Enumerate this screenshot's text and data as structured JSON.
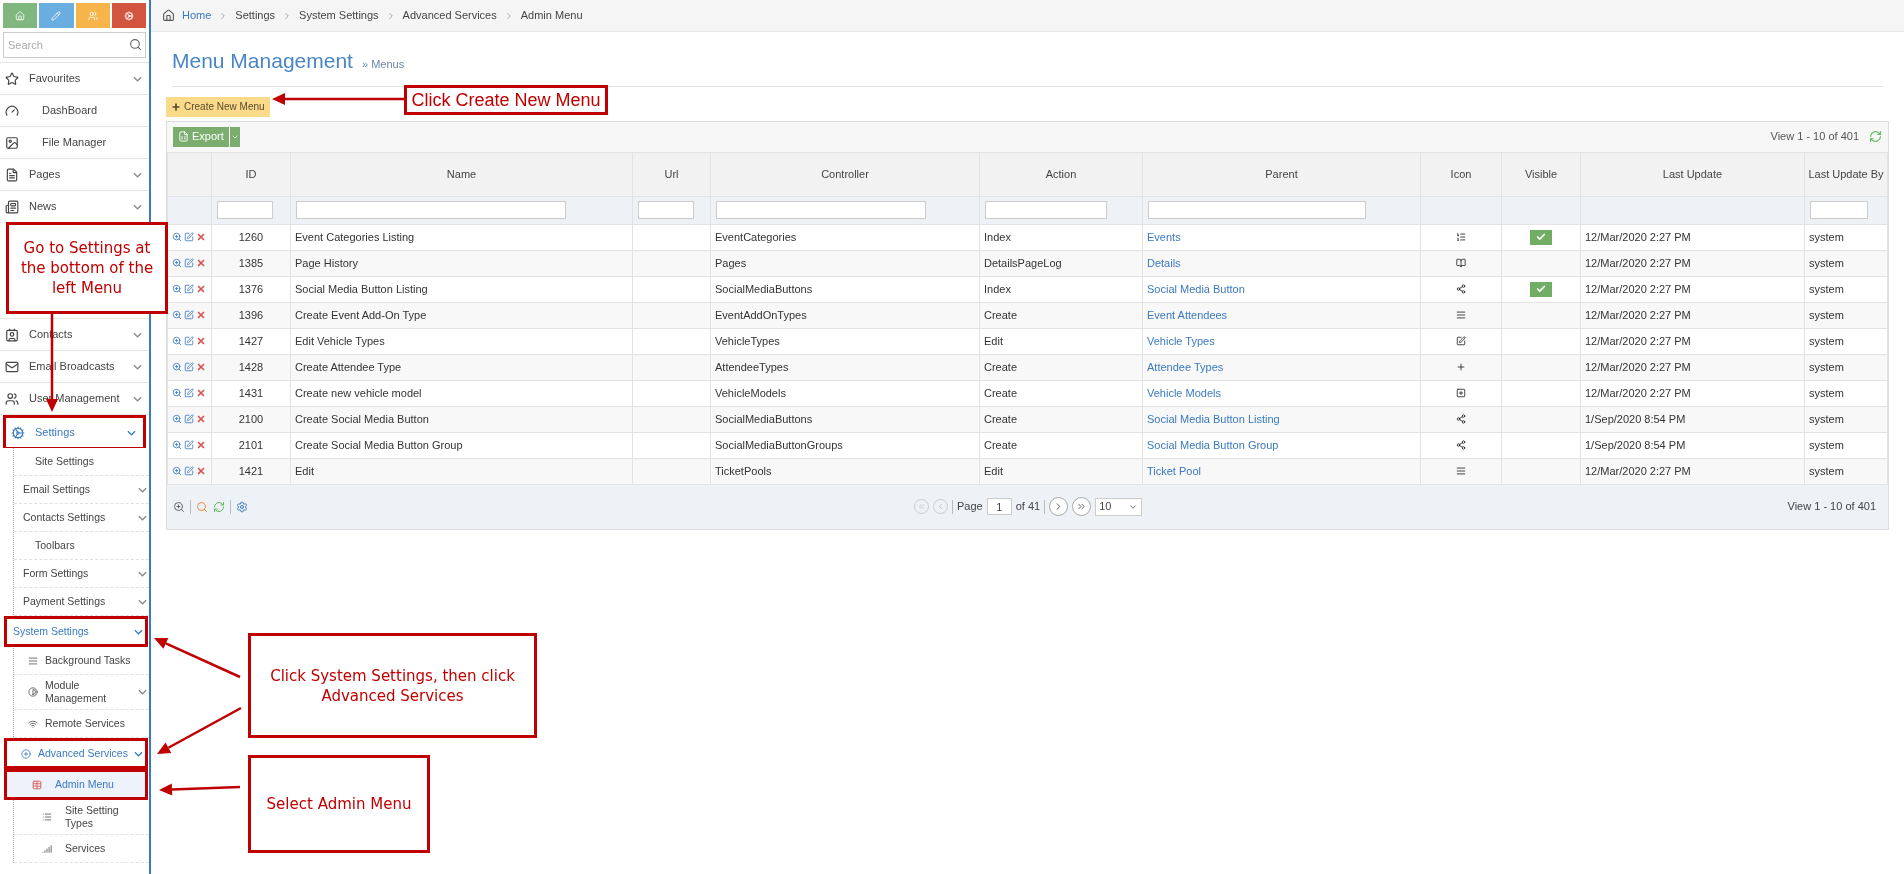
{
  "sidebar": {
    "search": {
      "placeholder": "Search"
    },
    "items": [
      {
        "label": "Favourites",
        "expanded": false,
        "selected": false
      },
      {
        "label": "DashBoard",
        "selected": false
      },
      {
        "label": "File Manager",
        "selected": false
      },
      {
        "label": "Pages",
        "expanded": false,
        "selected": false
      },
      {
        "label": "News",
        "expanded": false,
        "selected": false
      },
      {
        "label": "Contacts",
        "expanded": false,
        "selected": false
      },
      {
        "label": "Email Broadcasts",
        "expanded": false,
        "selected": false
      },
      {
        "label": "User Management",
        "expanded": false,
        "selected": false
      },
      {
        "label": "Settings",
        "expanded": true,
        "selected": false,
        "highlighted": true,
        "children": [
          {
            "label": "Site Settings",
            "selected": false
          },
          {
            "label": "Email Settings",
            "expanded": false,
            "selected": false
          },
          {
            "label": "Contacts Settings",
            "expanded": false,
            "selected": false
          },
          {
            "label": "Toolbars",
            "selected": false
          },
          {
            "label": "Form Settings",
            "expanded": false,
            "selected": false
          },
          {
            "label": "Payment Settings",
            "expanded": false,
            "selected": false
          },
          {
            "label": "System Settings",
            "expanded": true,
            "selected": false,
            "highlighted": true,
            "children": [
              {
                "label": "Background Tasks",
                "selected": false
              },
              {
                "label": "Module Management",
                "expanded": false,
                "selected": false
              },
              {
                "label": "Remote Services",
                "selected": false
              },
              {
                "label": "Advanced Services",
                "expanded": true,
                "selected": false,
                "highlighted": true,
                "children": [
                  {
                    "label": "Admin Menu",
                    "selected": true,
                    "highlighted": true
                  },
                  {
                    "label": "Site Setting Types",
                    "selected": false
                  },
                  {
                    "label": "Services",
                    "selected": false
                  }
                ]
              }
            ]
          }
        ]
      }
    ]
  },
  "breadcrumb": [
    "Home",
    "Settings",
    "System Settings",
    "Advanced Services",
    "Admin Menu"
  ],
  "page": {
    "title": "Menu Management",
    "subtitle": "» Menus",
    "create_button": "Create New Menu"
  },
  "table": {
    "export_button": "Export",
    "view_text": "View 1 - 10 of 401",
    "columns": [
      {
        "label": "ID",
        "filter": true
      },
      {
        "label": "Name",
        "filter": true
      },
      {
        "label": "Url",
        "filter": true
      },
      {
        "label": "Controller",
        "filter": true
      },
      {
        "label": "Action",
        "filter": true
      },
      {
        "label": "Parent",
        "filter": true
      },
      {
        "label": "Icon",
        "filter": false
      },
      {
        "label": "Visible",
        "filter": false
      },
      {
        "label": "Last Update",
        "filter": false
      },
      {
        "label": "Last Update By",
        "filter": true
      }
    ],
    "rows": [
      {
        "id": "1260",
        "name": "Event Categories Listing",
        "controller": "EventCategories",
        "action": "Index",
        "parent": "Events",
        "visible": true,
        "last_update": "12/Mar/2020 2:27 PM",
        "last_update_by": "system"
      },
      {
        "id": "1385",
        "name": "Page History",
        "controller": "Pages",
        "action": "DetailsPageLog",
        "parent": "Details",
        "visible": false,
        "last_update": "12/Mar/2020 2:27 PM",
        "last_update_by": "system"
      },
      {
        "id": "1376",
        "name": "Social Media Button Listing",
        "controller": "SocialMediaButtons",
        "action": "Index",
        "parent": "Social Media Button",
        "visible": true,
        "last_update": "12/Mar/2020 2:27 PM",
        "last_update_by": "system"
      },
      {
        "id": "1396",
        "name": "Create Event Add-On Type",
        "controller": "EventAddOnTypes",
        "action": "Create",
        "parent": "Event Attendees",
        "visible": false,
        "last_update": "12/Mar/2020 2:27 PM",
        "last_update_by": "system"
      },
      {
        "id": "1427",
        "name": "Edit Vehicle Types",
        "controller": "VehicleTypes",
        "action": "Edit",
        "parent": "Vehicle Types",
        "visible": false,
        "last_update": "12/Mar/2020 2:27 PM",
        "last_update_by": "system"
      },
      {
        "id": "1428",
        "name": "Create Attendee Type",
        "controller": "AttendeeTypes",
        "action": "Create",
        "parent": "Attendee Types",
        "visible": false,
        "last_update": "12/Mar/2020 2:27 PM",
        "last_update_by": "system"
      },
      {
        "id": "1431",
        "name": "Create new vehicle model",
        "controller": "VehicleModels",
        "action": "Create",
        "parent": "Vehicle Models",
        "visible": false,
        "last_update": "12/Mar/2020 2:27 PM",
        "last_update_by": "system"
      },
      {
        "id": "2100",
        "name": "Create Social Media Button",
        "controller": "SocialMediaButtons",
        "action": "Create",
        "parent": "Social Media Button Listing",
        "visible": false,
        "last_update": "1/Sep/2020 8:54 PM",
        "last_update_by": "system"
      },
      {
        "id": "2101",
        "name": "Create Social Media Button Group",
        "controller": "SocialMediaButtonGroups",
        "action": "Create",
        "parent": "Social Media Button Group",
        "visible": false,
        "last_update": "1/Sep/2020 8:54 PM",
        "last_update_by": "system"
      },
      {
        "id": "1421",
        "name": "Edit",
        "controller": "TicketPools",
        "action": "Edit",
        "parent": "Ticket Pool",
        "visible": false,
        "last_update": "12/Mar/2020 2:27 PM",
        "last_update_by": "system"
      }
    ],
    "pager": {
      "page_label": "Page",
      "page": "1",
      "page_count": "of 41",
      "page_size": "10",
      "view_text": "View 1 - 10 of 401"
    }
  },
  "annotations": [
    {
      "text": "Click Create New Menu"
    },
    {
      "text": "Go to Settings at the bottom of the left Menu"
    },
    {
      "text": "Click System Settings, then click Advanced Services"
    },
    {
      "text": "Select Admin Menu"
    }
  ]
}
